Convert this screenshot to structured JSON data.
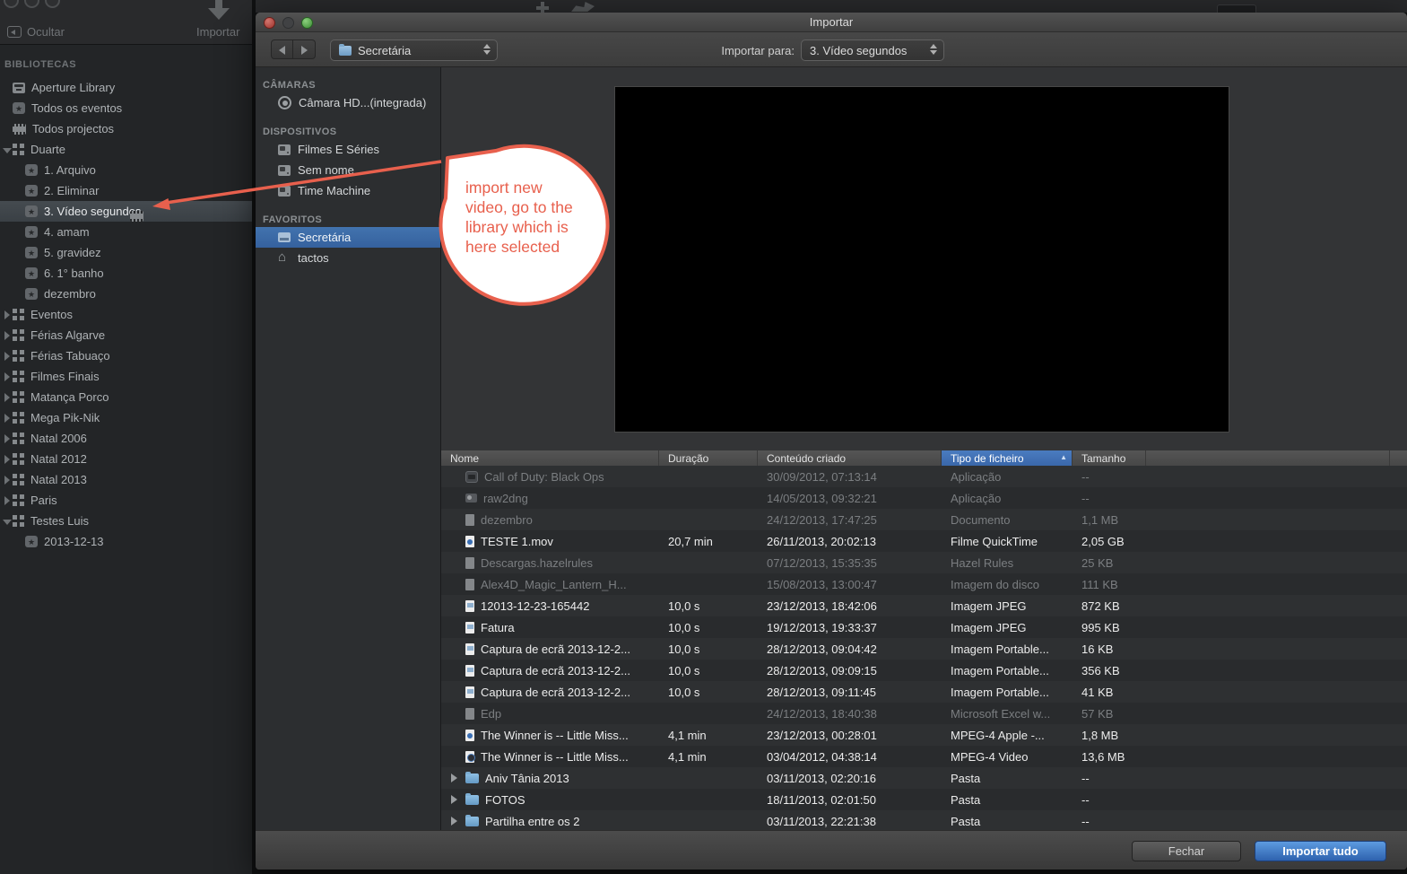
{
  "colors": {
    "accent_blue": "#3a67aa",
    "selection_blue": "#35619e",
    "annotation_red": "#e8604d"
  },
  "main_toolbar": {
    "hide_label": "Ocultar",
    "import_label": "Importar"
  },
  "sidebar": {
    "section_label": "BIBLIOTECAS",
    "items": [
      {
        "label": "Aperture Library",
        "icon": "library",
        "indent": 1
      },
      {
        "label": "Todos os eventos",
        "icon": "star",
        "indent": 1
      },
      {
        "label": "Todos projectos",
        "icon": "film",
        "indent": 1
      },
      {
        "label": "Duarte",
        "icon": "grid",
        "indent": 1,
        "disclosure": "down"
      },
      {
        "label": "1. Arquivo",
        "icon": "star",
        "indent": 2
      },
      {
        "label": "2. Eliminar",
        "icon": "star",
        "indent": 2
      },
      {
        "label": "3. Vídeo segundos",
        "icon": "star",
        "indent": 2,
        "selected": true,
        "trailing": "film"
      },
      {
        "label": "4. amam",
        "icon": "star",
        "indent": 2
      },
      {
        "label": "5. gravidez",
        "icon": "star",
        "indent": 2
      },
      {
        "label": "6. 1° banho",
        "icon": "star",
        "indent": 2
      },
      {
        "label": "dezembro",
        "icon": "star",
        "indent": 2
      },
      {
        "label": "Eventos",
        "icon": "grid",
        "indent": 1,
        "disclosure": "right"
      },
      {
        "label": "Férias Algarve",
        "icon": "grid",
        "indent": 1,
        "disclosure": "right"
      },
      {
        "label": "Férias Tabuaço",
        "icon": "grid",
        "indent": 1,
        "disclosure": "right"
      },
      {
        "label": "Filmes Finais",
        "icon": "grid",
        "indent": 1,
        "disclosure": "right"
      },
      {
        "label": "Matança Porco",
        "icon": "grid",
        "indent": 1,
        "disclosure": "right"
      },
      {
        "label": "Mega Pik-Nik",
        "icon": "grid",
        "indent": 1,
        "disclosure": "right"
      },
      {
        "label": "Natal 2006",
        "icon": "grid",
        "indent": 1,
        "disclosure": "right"
      },
      {
        "label": "Natal 2012",
        "icon": "grid",
        "indent": 1,
        "disclosure": "right"
      },
      {
        "label": "Natal 2013",
        "icon": "grid",
        "indent": 1,
        "disclosure": "right"
      },
      {
        "label": "Paris",
        "icon": "grid",
        "indent": 1,
        "disclosure": "right"
      },
      {
        "label": "Testes Luis",
        "icon": "grid",
        "indent": 1,
        "disclosure": "down"
      },
      {
        "label": "2013-12-13",
        "icon": "star",
        "indent": 2
      }
    ]
  },
  "dialog": {
    "title": "Importar",
    "toolbar": {
      "location_value": "Secretária",
      "import_to_label": "Importar para:",
      "import_to_value": "3. Vídeo segundos"
    },
    "sources": {
      "cameras_label": "CÂMARAS",
      "cameras": [
        {
          "label": "Câmara HD...(integrada)",
          "icon": "camera"
        }
      ],
      "devices_label": "DISPOSITIVOS",
      "devices": [
        {
          "label": "Filmes E Séries",
          "icon": "drive"
        },
        {
          "label": "Sem nome",
          "icon": "drive"
        },
        {
          "label": "Time Machine",
          "icon": "drive"
        }
      ],
      "favorites_label": "FAVORITOS",
      "favorites": [
        {
          "label": "Secretária",
          "icon": "desktop",
          "selected": true
        },
        {
          "label": "tactos",
          "icon": "home"
        }
      ]
    },
    "table": {
      "columns": [
        "Nome",
        "Duração",
        "Conteúdo criado",
        "Tipo de ficheiro",
        "Tamanho"
      ],
      "sort_column": "Tipo de ficheiro",
      "sort_indicator": "▲",
      "rows": [
        {
          "name": "Call of Duty: Black Ops",
          "icon": "app",
          "dim": true,
          "duration": "",
          "created": "30/09/2012, 07:13:14",
          "type": "Aplicação",
          "size": "--"
        },
        {
          "name": "raw2dng",
          "icon": "appsmall",
          "dim": true,
          "duration": "",
          "created": "14/05/2013, 09:32:21",
          "type": "Aplicação",
          "size": "--"
        },
        {
          "name": "dezembro",
          "icon": "doc",
          "dim": true,
          "duration": "",
          "created": "24/12/2013, 17:47:25",
          "type": "Documento",
          "size": "1,1 MB"
        },
        {
          "name": "TESTE 1.mov",
          "icon": "movie",
          "duration": "20,7 min",
          "created": "26/11/2013, 20:02:13",
          "type": "Filme QuickTime",
          "size": "2,05 GB"
        },
        {
          "name": "Descargas.hazelrules",
          "icon": "doc",
          "dim": true,
          "duration": "",
          "created": "07/12/2013, 15:35:35",
          "type": "Hazel Rules",
          "size": "25 KB"
        },
        {
          "name": "Alex4D_Magic_Lantern_H...",
          "icon": "doc",
          "dim": true,
          "duration": "",
          "created": "15/08/2013, 13:00:47",
          "type": "Imagem do disco",
          "size": "111 KB"
        },
        {
          "name": "12013-12-23-165442",
          "icon": "img",
          "duration": "10,0 s",
          "created": "23/12/2013, 18:42:06",
          "type": "Imagem JPEG",
          "size": "872 KB"
        },
        {
          "name": "Fatura",
          "icon": "img",
          "duration": "10,0 s",
          "created": "19/12/2013, 19:33:37",
          "type": "Imagem JPEG",
          "size": "995 KB"
        },
        {
          "name": "Captura de ecrã 2013-12-2...",
          "icon": "img",
          "duration": "10,0 s",
          "created": "28/12/2013, 09:04:42",
          "type": "Imagem Portable...",
          "size": "16 KB"
        },
        {
          "name": "Captura de ecrã 2013-12-2...",
          "icon": "img",
          "duration": "10,0 s",
          "created": "28/12/2013, 09:09:15",
          "type": "Imagem Portable...",
          "size": "356 KB"
        },
        {
          "name": "Captura de ecrã 2013-12-2...",
          "icon": "img",
          "duration": "10,0 s",
          "created": "28/12/2013, 09:11:45",
          "type": "Imagem Portable...",
          "size": "41 KB"
        },
        {
          "name": "Edp",
          "icon": "doc",
          "dim": true,
          "duration": "",
          "created": "24/12/2013, 18:40:38",
          "type": "Microsoft Excel w...",
          "size": "57 KB"
        },
        {
          "name": "The Winner is -- Little Miss...",
          "icon": "movie",
          "duration": "4,1 min",
          "created": "23/12/2013, 00:28:01",
          "type": "MPEG-4 Apple -...",
          "size": "1,8 MB"
        },
        {
          "name": "The Winner is -- Little Miss...",
          "icon": "movie2",
          "duration": "4,1 min",
          "created": "03/04/2012, 04:38:14",
          "type": "MPEG-4 Video",
          "size": "13,6 MB"
        },
        {
          "name": "Aniv Tânia 2013",
          "icon": "folder",
          "folder": true,
          "duration": "",
          "created": "03/11/2013, 02:20:16",
          "type": "Pasta",
          "size": "--"
        },
        {
          "name": "FOTOS",
          "icon": "folder",
          "folder": true,
          "duration": "",
          "created": "18/11/2013, 02:01:50",
          "type": "Pasta",
          "size": "--"
        },
        {
          "name": "Partilha entre os 2",
          "icon": "folder",
          "folder": true,
          "duration": "",
          "created": "03/11/2013, 22:21:38",
          "type": "Pasta",
          "size": "--"
        }
      ]
    },
    "footer": {
      "close_label": "Fechar",
      "import_all_label": "Importar tudo"
    }
  },
  "annotation": {
    "text": "import new\nvideo, go to the\nlibrary which is\nhere selected"
  }
}
